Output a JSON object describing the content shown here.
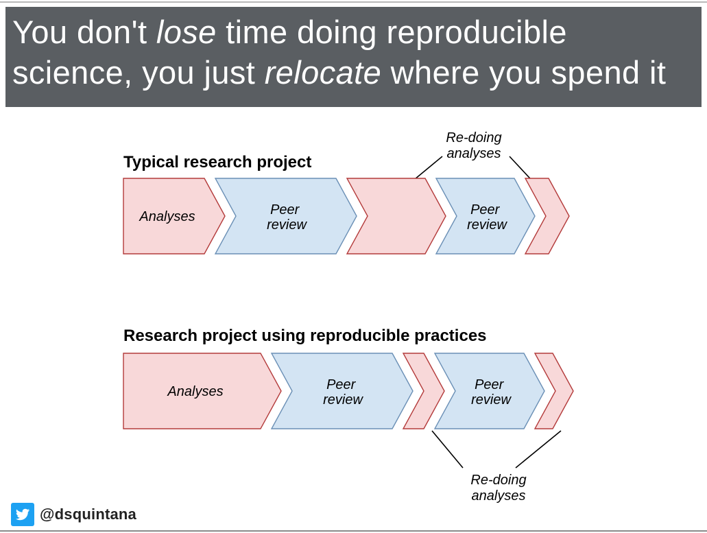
{
  "title": {
    "pre": "You don't ",
    "em1": "lose",
    "mid": " time doing reproducible science, you just ",
    "em2": "relocate",
    "post": " where you spend it"
  },
  "top": {
    "heading": "Typical research project",
    "annotation_l1": "Re-doing",
    "annotation_l2": "analyses",
    "step1": "Analyses",
    "step2_l1": "Peer",
    "step2_l2": "review",
    "step3_l1": "Peer",
    "step3_l2": "review"
  },
  "bottom": {
    "heading": "Research project using reproducible practices",
    "annotation_l1": "Re-doing",
    "annotation_l2": "analyses",
    "step1": "Analyses",
    "step2_l1": "Peer",
    "step2_l2": "review",
    "step3_l1": "Peer",
    "step3_l2": "review"
  },
  "footer": {
    "handle": "@dsquintana"
  },
  "colors": {
    "pink_fill": "#f8d8d9",
    "pink_stroke": "#b33a3a",
    "blue_fill": "#d3e4f3",
    "blue_stroke": "#6a8fb5"
  }
}
